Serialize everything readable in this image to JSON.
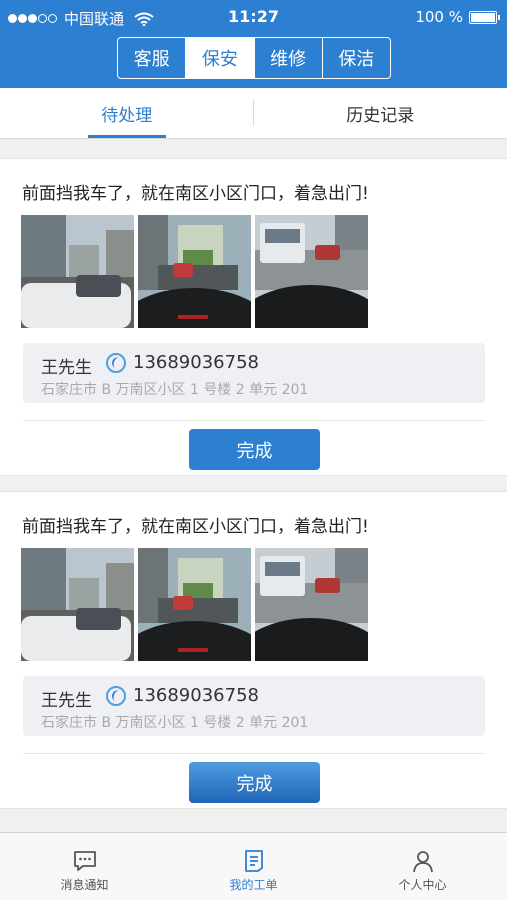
{
  "status_bar": {
    "carrier": "中国联通",
    "time": "11:27",
    "battery": "100 %",
    "signal_strength": "3 of 5"
  },
  "segments": [
    {
      "label": "客服",
      "active": false
    },
    {
      "label": "保安",
      "active": true
    },
    {
      "label": "维修",
      "active": false
    },
    {
      "label": "保洁",
      "active": false
    }
  ],
  "tabs": {
    "pending": "待处理",
    "history": "历史记录"
  },
  "orders": [
    {
      "message": "前面挡我车了，就在南区小区门口，着急出门!",
      "photos": [
        "street-photo",
        "car-interior-photo",
        "truck-photo"
      ],
      "contact_name": "王先生",
      "phone": "13689036758",
      "address": "石家庄市 B 万南区小区 1 号楼 2 单元 201",
      "done_label": "完成"
    },
    {
      "message": "前面挡我车了，就在南区小区门口，着急出门!",
      "photos": [
        "street-photo",
        "car-interior-photo",
        "truck-photo"
      ],
      "contact_name": "王先生",
      "phone": "13689036758",
      "address": "石家庄市 B 万南区小区 1 号楼 2 单元 201",
      "done_label": "完成"
    }
  ],
  "tabbar": {
    "messages": "消息通知",
    "my_orders": "我的工单",
    "profile": "个人中心"
  },
  "colors": {
    "accent": "#2d7fd2",
    "background": "#f0f0f0",
    "contact_bg": "#eef0f4"
  }
}
